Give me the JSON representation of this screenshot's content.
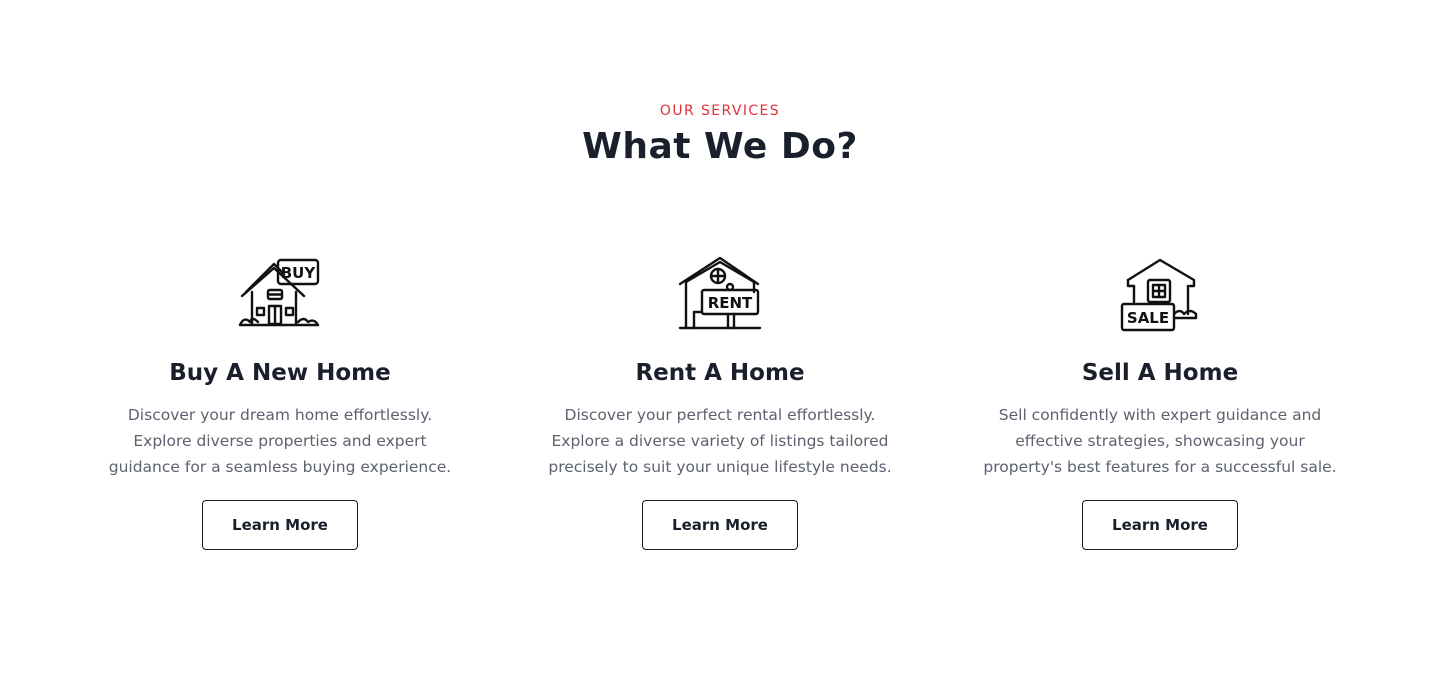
{
  "section": {
    "eyebrow": "OUR SERVICES",
    "title": "What We Do?"
  },
  "colors": {
    "accent": "#e0323a",
    "heading": "#1a1f2c",
    "body_text": "#5d6270",
    "background": "#ffffff"
  },
  "cards": [
    {
      "icon": "buy-house-icon",
      "sign_text": "BUY",
      "title": "Buy A New Home",
      "text": "Discover your dream home effortlessly. Explore diverse properties and expert guidance for a seamless buying experience.",
      "button_label": "Learn More"
    },
    {
      "icon": "rent-house-icon",
      "sign_text": "RENT",
      "title": "Rent A Home",
      "text": "Discover your perfect rental effortlessly. Explore a diverse variety of listings tailored precisely to suit your unique lifestyle needs.",
      "button_label": "Learn More"
    },
    {
      "icon": "sale-house-icon",
      "sign_text": "SALE",
      "title": "Sell A Home",
      "text": "Sell confidently with expert guidance and effective strategies, showcasing your property's best features for a successful sale.",
      "button_label": "Learn More"
    }
  ]
}
